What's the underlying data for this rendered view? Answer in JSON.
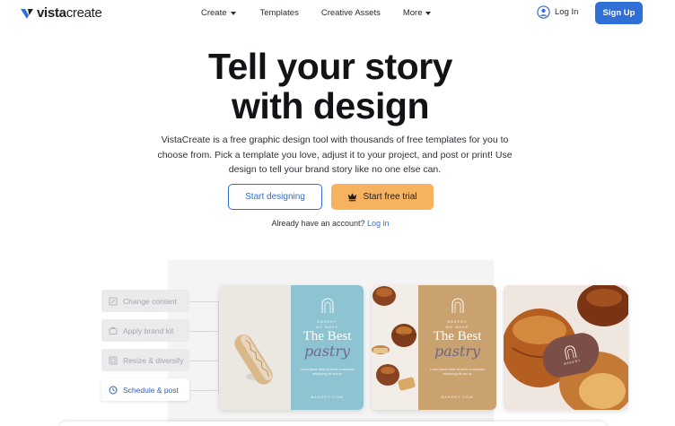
{
  "brand": {
    "logo_bold": "vista",
    "logo_light": "create",
    "accent": "#2f6fd6",
    "trial_color": "#f6b25e"
  },
  "nav": {
    "links": [
      "Create",
      "Templates",
      "Creative Assets",
      "More"
    ],
    "login_label": "Log In",
    "signup_label": "Sign Up"
  },
  "hero": {
    "title_line1": "Tell your story",
    "title_line2": "with design",
    "description": "VistaCreate is a free graphic design tool with thousands of free templates for you to choose from. Pick a template you love, adjust it to your project, and post or print! Use design to tell your brand story like no one else can.",
    "start_button": "Start designing",
    "trial_button": "Start free trial",
    "account_prompt": "Already have an account?",
    "account_login": "Log in"
  },
  "showcase": {
    "features": [
      {
        "label": "Change content",
        "icon": "edit-icon",
        "active": false
      },
      {
        "label": "Apply brand kit",
        "icon": "brand-kit-icon",
        "active": false
      },
      {
        "label": "Resize & diversify",
        "icon": "resize-icon",
        "active": false
      },
      {
        "label": "Schedule & post",
        "icon": "clock-icon",
        "active": true
      }
    ],
    "poster1": {
      "tag": "WE MAKE",
      "headline": "The Best",
      "script": "pastry",
      "fine": "Lorem ipsum dolor sit amet consectetur adipiscing elit sed do",
      "footer": "BAKERY.COM"
    },
    "poster2": {
      "tag": "WE MAKE",
      "headline": "The Best",
      "script": "pastry",
      "fine": "Lorem ipsum dolor sit amet consectetur adipiscing elit sed do",
      "footer": "BAKERY.COM"
    },
    "badge_text": "BAKERY"
  }
}
